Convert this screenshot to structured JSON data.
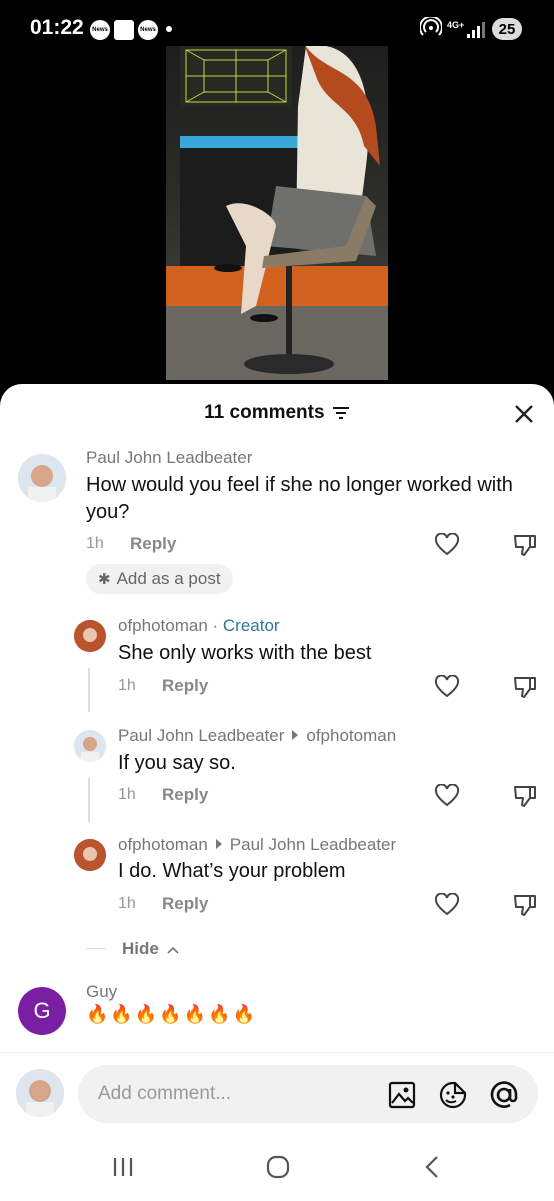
{
  "status": {
    "time": "01:22",
    "news1": "News",
    "news2": "News",
    "network": "4G+",
    "battery": "25"
  },
  "sheet": {
    "title": "11 comments"
  },
  "comments": [
    {
      "author": "Paul John Leadbeater",
      "text": "How would you feel if she no longer worked with you?",
      "time": "1h",
      "reply": "Reply",
      "add_post": "Add as a post"
    },
    {
      "author": "ofphotoman",
      "sep": " · ",
      "badge": "Creator",
      "text": "She only works with the best",
      "time": "1h",
      "reply": "Reply"
    },
    {
      "author": "Paul John Leadbeater",
      "reply_to": "ofphotoman",
      "text": "If you say so.",
      "time": "1h",
      "reply": "Reply"
    },
    {
      "author": "ofphotoman",
      "reply_to": "Paul John Leadbeater",
      "text": "I do. What’s your problem",
      "time": "1h",
      "reply": "Reply"
    },
    {
      "author": "Guy",
      "initial": "G",
      "text": "🔥🔥🔥🔥🔥🔥🔥"
    }
  ],
  "hide_label": "Hide",
  "input": {
    "placeholder": "Add comment..."
  },
  "colors": {
    "creator": "#2b7a90",
    "avatar_purple": "#7b1fa2"
  }
}
